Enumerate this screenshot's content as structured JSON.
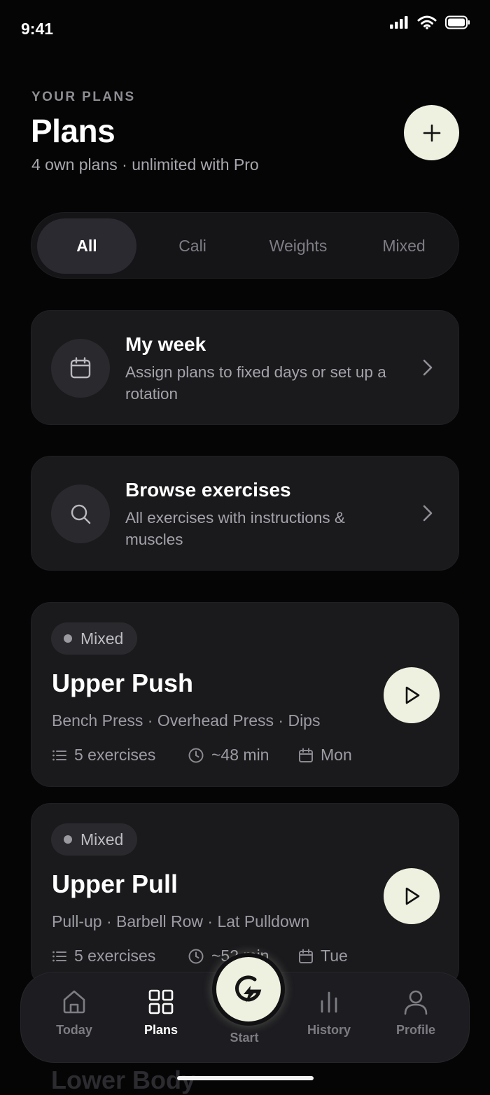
{
  "status": {
    "time": "9:41"
  },
  "header": {
    "eyebrow": "YOUR PLANS",
    "title": "Plans",
    "subtitle": "4 own plans · unlimited with Pro",
    "add_icon": "plus-icon"
  },
  "filters": {
    "options": [
      "All",
      "Cali",
      "Weights",
      "Mixed"
    ],
    "selected": "All"
  },
  "links": [
    {
      "title": "My week",
      "description": "Assign plans to fixed days or set up a rotation",
      "icon": "calendar-icon"
    },
    {
      "title": "Browse exercises",
      "description": "All exercises with instructions & muscles",
      "icon": "search-icon"
    }
  ],
  "plans": [
    {
      "type": "Mixed",
      "name": "Upper Push",
      "exercises": "Bench Press · Overhead Press · Dips",
      "count": "5 exercises",
      "duration": "~48 min",
      "day": "Mon"
    },
    {
      "type": "Mixed",
      "name": "Upper Pull",
      "exercises": "Pull-up · Barbell Row · Lat Pulldown",
      "count": "5 exercises",
      "duration": "~52 min",
      "day": "Tue"
    },
    {
      "type": "",
      "name": "Lower Body",
      "exercises": "",
      "count": "",
      "duration": "",
      "day": ""
    }
  ],
  "nav": {
    "items": [
      {
        "label": "Today",
        "icon": "home-icon"
      },
      {
        "label": "Plans",
        "icon": "grid-icon"
      },
      {
        "label": "Start",
        "icon": "bolt-logo-icon"
      },
      {
        "label": "History",
        "icon": "bar-chart-icon"
      },
      {
        "label": "Profile",
        "icon": "user-icon"
      }
    ],
    "active": "Plans"
  },
  "colors": {
    "background": "#050506",
    "card": "#1a1a1d",
    "accent": "#eef1df"
  }
}
